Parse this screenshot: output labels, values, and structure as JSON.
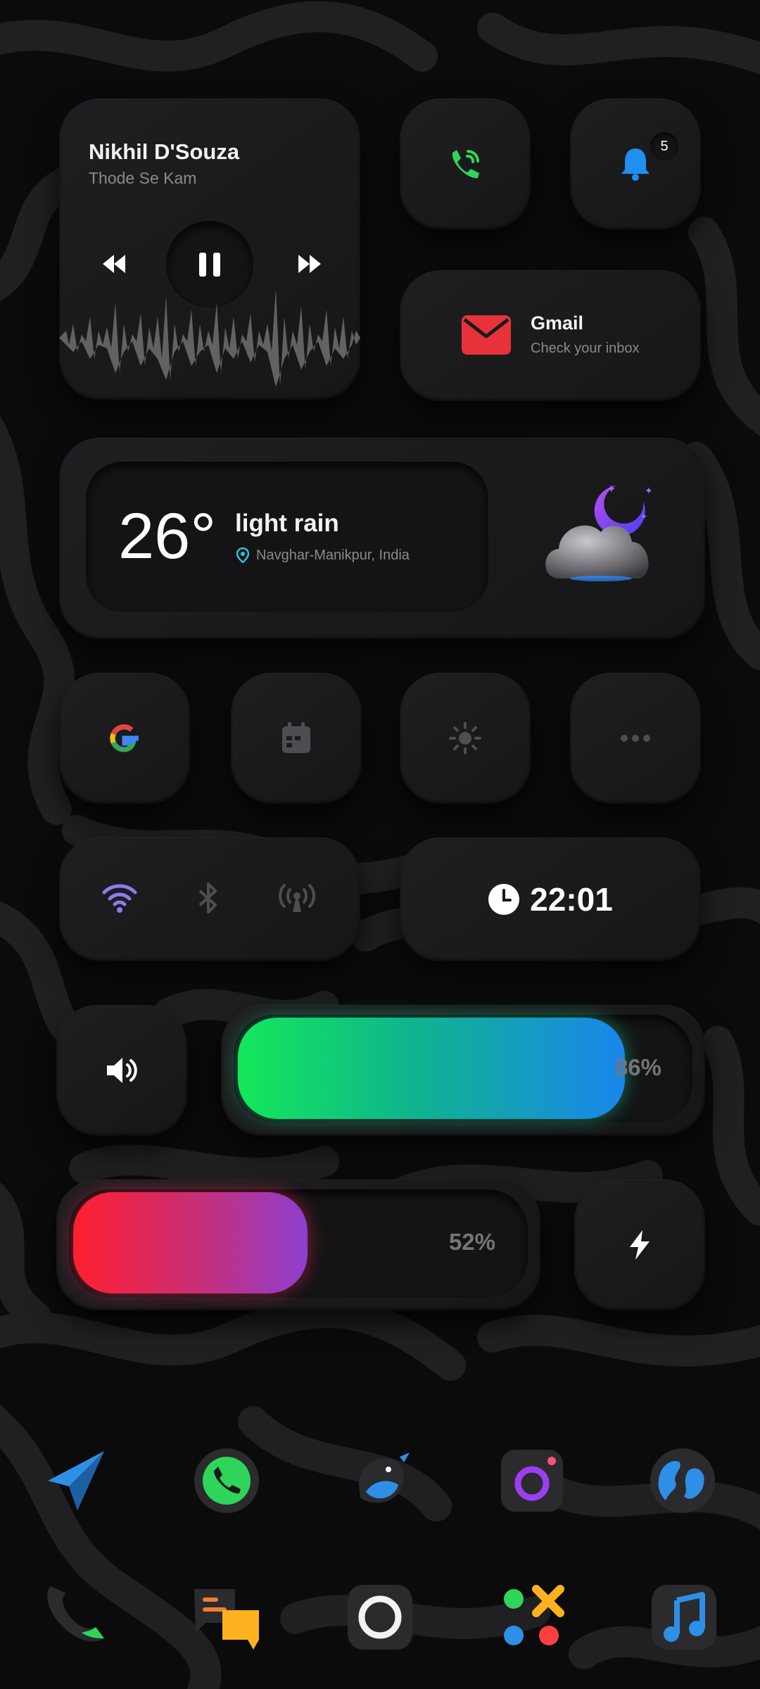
{
  "music": {
    "artist": "Nikhil D'Souza",
    "track": "Thode Se Kam"
  },
  "notifications": {
    "count": "5"
  },
  "gmail": {
    "title": "Gmail",
    "subtitle": "Check your inbox"
  },
  "weather": {
    "temperature": "26°",
    "condition": "light rain",
    "location": "Navghar-Manikpur, India"
  },
  "clock": {
    "time": "22:01"
  },
  "volume": {
    "percent_label": "86%",
    "level": 0.86
  },
  "battery": {
    "percent_label": "52%",
    "level": 0.52
  },
  "colors": {
    "accent_green": "#2fd55b",
    "accent_blue": "#1f8ff0",
    "gmail_red": "#e8323a",
    "battery_red": "#ff1f2f",
    "battery_purple": "#8e3fd0"
  },
  "quick_icons": [
    "google-icon",
    "calendar-icon",
    "brightness-icon",
    "more-icon"
  ],
  "toggles": [
    "wifi-icon",
    "bluetooth-icon",
    "hotspot-icon"
  ],
  "dock_row1": [
    "telegram-icon",
    "whatsapp-icon",
    "twitter-bird-icon",
    "camera-icon",
    "browser-globe-icon"
  ],
  "dock_row2": [
    "phone-icon",
    "messages-icon",
    "camera-lens-icon",
    "games-icon",
    "music-icon"
  ]
}
